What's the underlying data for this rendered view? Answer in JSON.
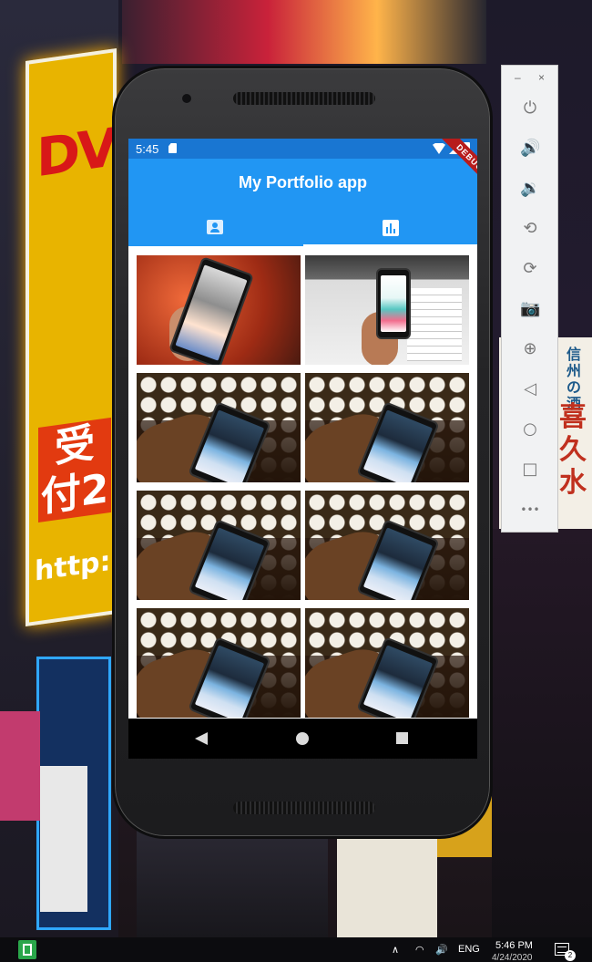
{
  "app": {
    "title": "My Portfolio app",
    "debug_banner": "DEBUG",
    "accent_color": "#2196f3",
    "statusbar_color": "#1976d2"
  },
  "status_bar": {
    "time": "5:45",
    "icons": [
      "sd-card-icon",
      "wifi-icon",
      "signal-icon",
      "battery-icon"
    ]
  },
  "tabs": [
    {
      "icon": "contact-icon",
      "active": false
    },
    {
      "icon": "bar-chart-icon",
      "active": true
    }
  ],
  "gallery": {
    "columns": 2,
    "tiles": [
      {
        "image": "phone-in-hand-red-background"
      },
      {
        "image": "phone-in-hand-desk-with-papers"
      },
      {
        "image": "phone-in-hand-bokeh-lights"
      },
      {
        "image": "phone-in-hand-bokeh-lights"
      },
      {
        "image": "phone-in-hand-bokeh-lights"
      },
      {
        "image": "phone-in-hand-bokeh-lights"
      },
      {
        "image": "phone-in-hand-bokeh-lights"
      },
      {
        "image": "phone-in-hand-bokeh-lights"
      }
    ]
  },
  "nav_bar": {
    "buttons": [
      "back-icon",
      "home-icon",
      "recents-icon"
    ]
  },
  "emulator_panel": {
    "window_controls": {
      "minimize": "–",
      "close": "×"
    },
    "buttons": [
      {
        "name": "power-icon",
        "glyph": "⏻"
      },
      {
        "name": "volume-up-icon",
        "glyph": "🔊"
      },
      {
        "name": "volume-down-icon",
        "glyph": "🔉"
      },
      {
        "name": "rotate-left-icon",
        "glyph": "⟲"
      },
      {
        "name": "rotate-right-icon",
        "glyph": "⟳"
      },
      {
        "name": "camera-icon",
        "glyph": "📷"
      },
      {
        "name": "zoom-icon",
        "glyph": "⊕"
      },
      {
        "name": "back-icon",
        "glyph": "◁"
      },
      {
        "name": "home-icon",
        "glyph": "○"
      },
      {
        "name": "overview-icon",
        "glyph": "□"
      },
      {
        "name": "more-icon",
        "glyph": "•••"
      }
    ]
  },
  "wallpaper_signs": {
    "dvd": "DVD",
    "jp_big": "受付2",
    "web": "http:",
    "jp_right_small": "信州の酒",
    "jp_right_big": "喜久水"
  },
  "taskbar": {
    "language": "ENG",
    "time": "5:46 PM",
    "date": "4/24/2020",
    "notification_count": "2"
  }
}
